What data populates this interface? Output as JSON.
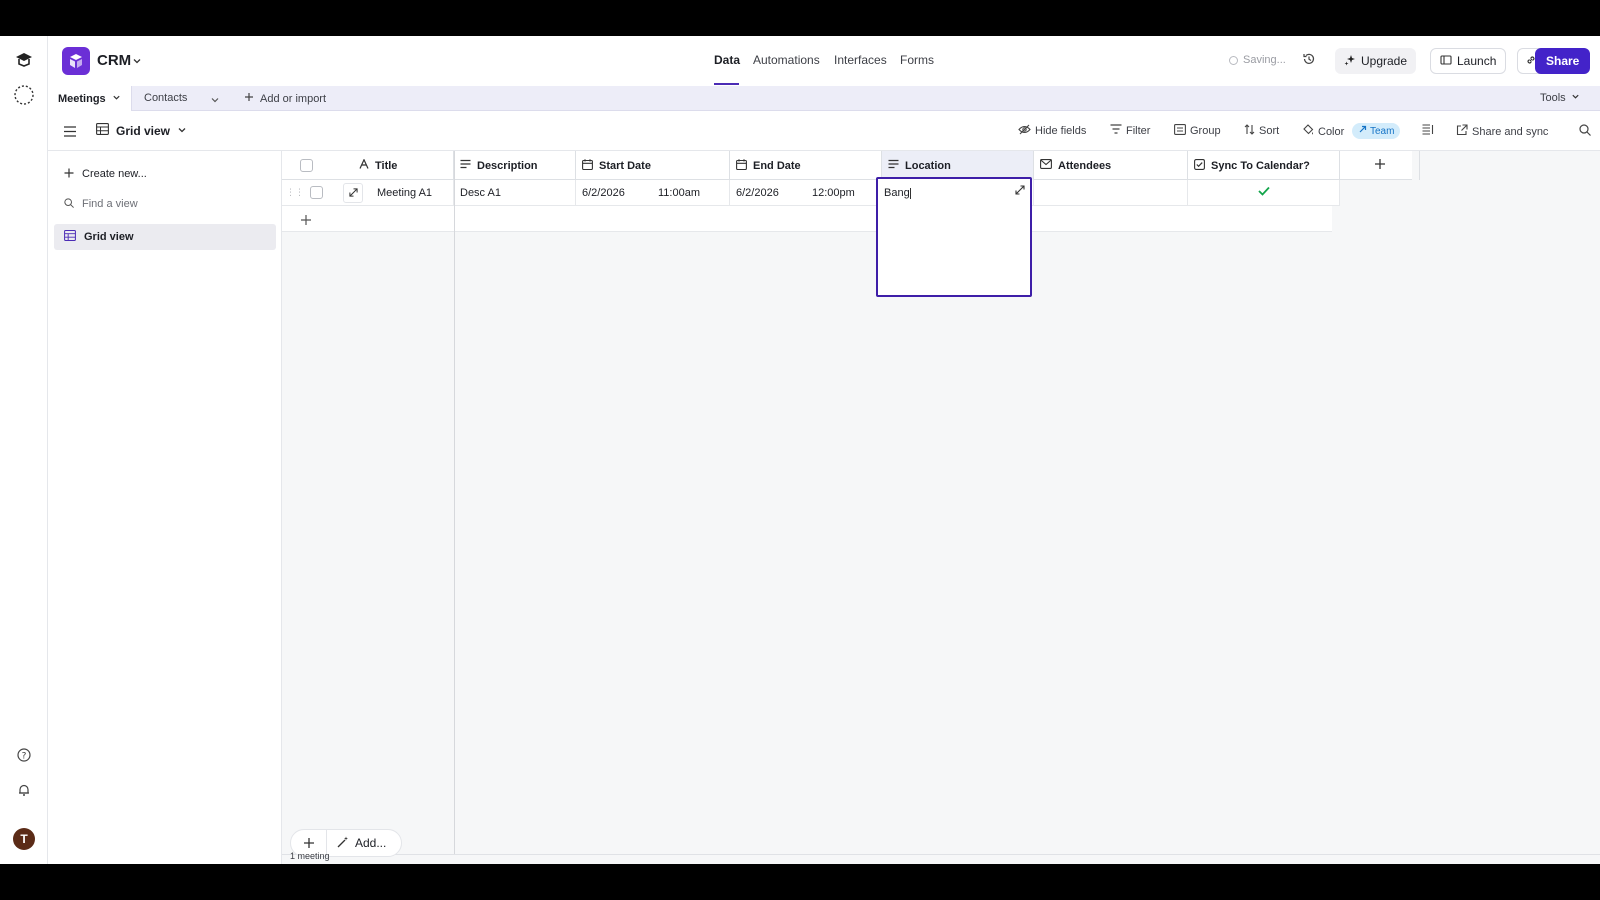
{
  "app": {
    "base_name": "CRM",
    "brand_color": "#6b2fd6",
    "accent_color": "#4323c9",
    "user_initial": "T"
  },
  "topbar": {
    "tabs": [
      "Data",
      "Automations",
      "Interfaces",
      "Forms"
    ],
    "active_tab": "Data",
    "status": "Saving...",
    "upgrade_label": "Upgrade",
    "launch_label": "Launch",
    "share_label": "Share"
  },
  "tablebar": {
    "tables": [
      "Meetings",
      "Contacts"
    ],
    "active_table": "Meetings",
    "add_label": "Add or import",
    "tools_label": "Tools"
  },
  "viewbar": {
    "current_view": "Grid view",
    "tools": {
      "hide_fields": "Hide fields",
      "filter": "Filter",
      "group": "Group",
      "sort": "Sort",
      "color": "Color",
      "team_badge": "Team",
      "share_sync": "Share and sync"
    }
  },
  "views_panel": {
    "create_new": "Create new...",
    "find_placeholder": "Find a view",
    "views": [
      "Grid view"
    ]
  },
  "grid": {
    "columns": [
      {
        "name": "Title",
        "icon": "text-type-icon"
      },
      {
        "name": "Description",
        "icon": "long-text-icon"
      },
      {
        "name": "Start Date",
        "icon": "calendar-icon"
      },
      {
        "name": "End Date",
        "icon": "calendar-icon"
      },
      {
        "name": "Location",
        "icon": "long-text-icon"
      },
      {
        "name": "Attendees",
        "icon": "email-icon"
      },
      {
        "name": "Sync To Calendar?",
        "icon": "checkbox-icon"
      }
    ],
    "rows": [
      {
        "title": "Meeting A1",
        "description": "Desc A1",
        "start_date": "6/2/2026",
        "start_time": "11:00am",
        "end_date": "6/2/2026",
        "end_time": "12:00pm",
        "location": "Bang",
        "attendees": "",
        "sync_to_calendar": true
      }
    ],
    "footer_add_label": "Add...",
    "record_count": "1 meeting"
  }
}
